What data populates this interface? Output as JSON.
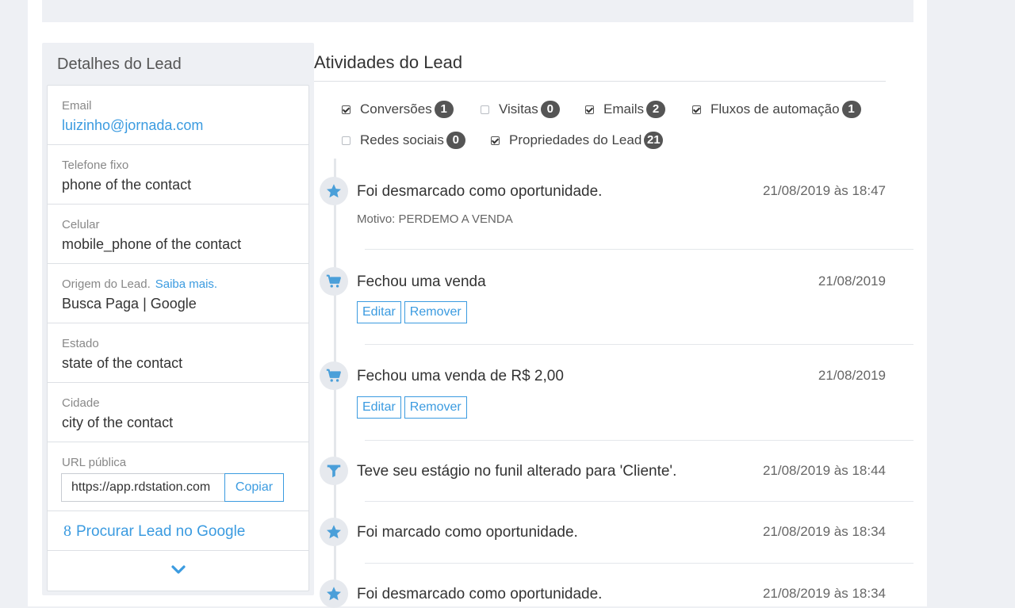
{
  "details": {
    "title": "Detalhes do Lead",
    "email": {
      "label": "Email",
      "value": "luizinho@jornada.com"
    },
    "phone": {
      "label": "Telefone fixo",
      "value": "phone of the contact"
    },
    "mobile": {
      "label": "Celular",
      "value": "mobile_phone of the contact"
    },
    "origin": {
      "label": "Origem do Lead.",
      "link": "Saiba mais.",
      "value": "Busca Paga | Google"
    },
    "state": {
      "label": "Estado",
      "value": "state of the contact"
    },
    "city": {
      "label": "Cidade",
      "value": "city of the contact"
    },
    "public_url": {
      "label": "URL pública",
      "value": "https://app.rdstation.com",
      "copy_label": "Copiar"
    },
    "google_search": {
      "icon": "google-plus-icon",
      "glyph": "8",
      "label": "Procurar Lead no Google"
    },
    "expand_icon": "chevron-down-icon"
  },
  "activities": {
    "title": "Atividades do Lead",
    "filters": [
      {
        "label": "Conversões",
        "count": "1",
        "checked": true
      },
      {
        "label": "Visitas",
        "count": "0",
        "checked": false
      },
      {
        "label": "Emails",
        "count": "2",
        "checked": true
      },
      {
        "label": "Fluxos de automação",
        "count": "1",
        "checked": true
      },
      {
        "label": "Redes sociais",
        "count": "0",
        "checked": false
      },
      {
        "label": "Propriedades do Lead",
        "count": "21",
        "checked": true
      }
    ],
    "events": [
      {
        "icon": "star-icon",
        "text": "Foi desmarcado como oportunidade.",
        "date": "21/08/2019 às 18:47",
        "detail": "Motivo: PERDEMO A VENDA"
      },
      {
        "icon": "cart-icon",
        "text": "Fechou uma venda",
        "date": "21/08/2019",
        "edit": "Editar",
        "remove": "Remover"
      },
      {
        "icon": "cart-icon",
        "text": "Fechou uma venda de R$ 2,00",
        "date": "21/08/2019",
        "edit": "Editar",
        "remove": "Remover"
      },
      {
        "icon": "funnel-icon",
        "text": "Teve seu estágio no funil alterado para 'Cliente'.",
        "date": "21/08/2019 às 18:44"
      },
      {
        "icon": "star-icon",
        "text": "Foi marcado como oportunidade.",
        "date": "21/08/2019 às 18:34"
      },
      {
        "icon": "star-icon",
        "text": "Foi desmarcado como oportunidade.",
        "date": "21/08/2019 às 18:34"
      }
    ]
  },
  "colors": {
    "accent": "#3b9be0",
    "icon": "#4a9fd9",
    "badge": "#555555",
    "panel": "#eef0f4"
  }
}
